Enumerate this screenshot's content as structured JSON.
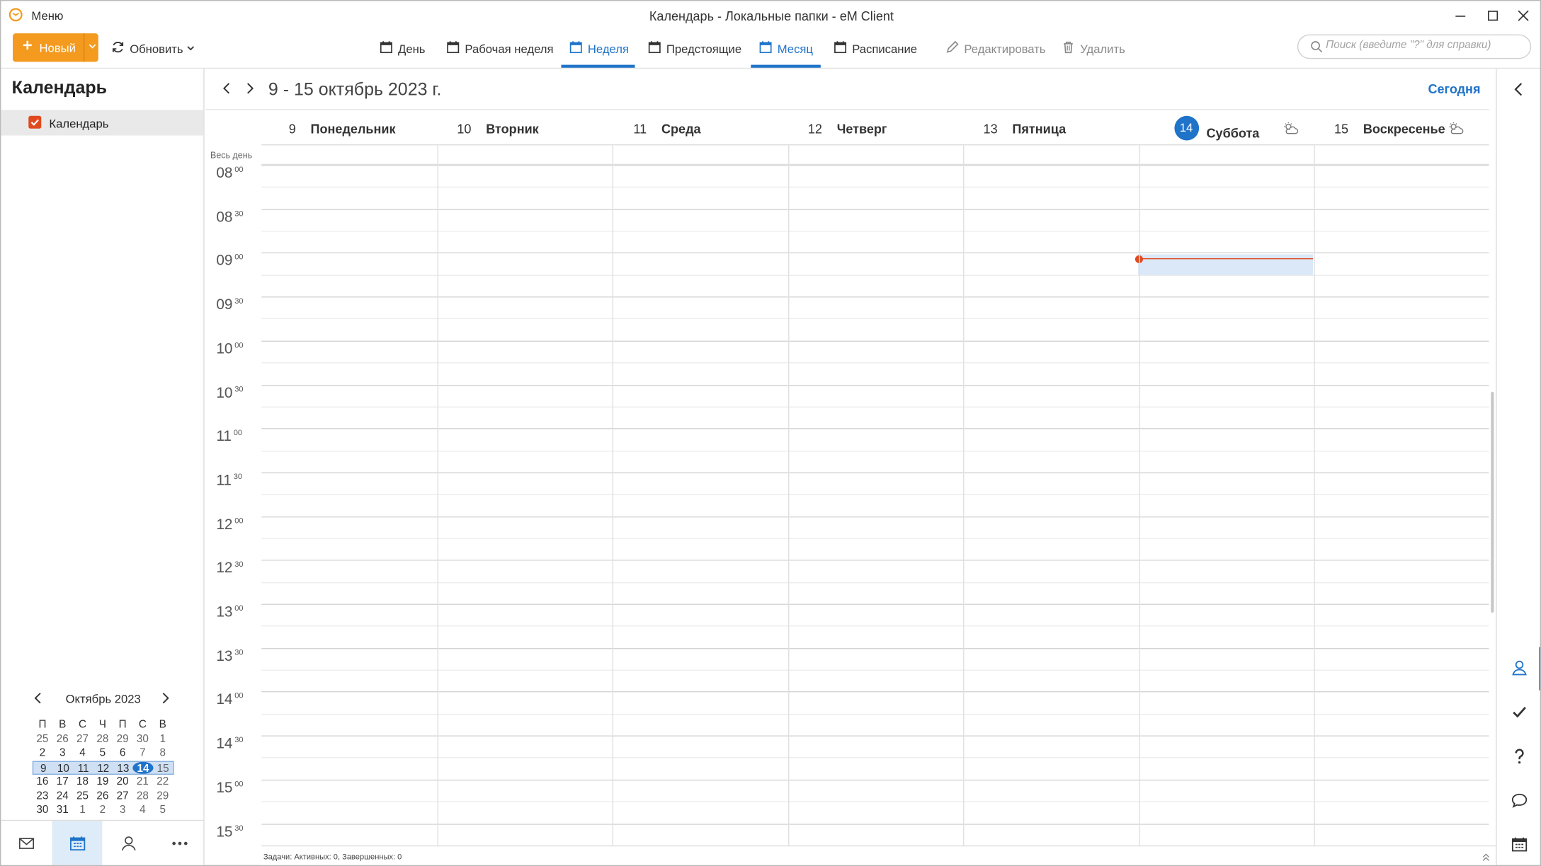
{
  "window": {
    "title": "Календарь - Локальные папки - eM Client",
    "menu_label": "Меню"
  },
  "toolbar": {
    "new_label": "Новый",
    "refresh_label": "Обновить",
    "views": [
      {
        "label": "День",
        "icon": "calendar-day-icon",
        "active": false
      },
      {
        "label": "Рабочая неделя",
        "icon": "calendar-workweek-icon",
        "active": false
      },
      {
        "label": "Неделя",
        "icon": "calendar-week-icon",
        "active": true
      },
      {
        "label": "Предстоящие",
        "icon": "calendar-upcoming-icon",
        "active": false
      },
      {
        "label": "Месяц",
        "icon": "calendar-month-icon",
        "active": true
      },
      {
        "label": "Расписание",
        "icon": "calendar-schedule-icon",
        "active": false
      }
    ],
    "edit_label": "Редактировать",
    "delete_label": "Удалить",
    "search_placeholder": "Поиск (введите \"?\" для справки)"
  },
  "sidebar": {
    "title": "Календарь",
    "calendars": [
      {
        "label": "Календарь",
        "checked": true,
        "color": "#e04a1f"
      }
    ]
  },
  "mini_calendar": {
    "title": "Октябрь 2023",
    "weekdays": [
      "П",
      "В",
      "С",
      "Ч",
      "П",
      "С",
      "В"
    ],
    "weeks": [
      [
        "25",
        "26",
        "27",
        "28",
        "29",
        "30",
        "1"
      ],
      [
        "2",
        "3",
        "4",
        "5",
        "6",
        "7",
        "8"
      ],
      [
        "9",
        "10",
        "11",
        "12",
        "13",
        "14",
        "15"
      ],
      [
        "16",
        "17",
        "18",
        "19",
        "20",
        "21",
        "22"
      ],
      [
        "23",
        "24",
        "25",
        "26",
        "27",
        "28",
        "29"
      ],
      [
        "30",
        "31",
        "1",
        "2",
        "3",
        "4",
        "5"
      ]
    ],
    "today": "14"
  },
  "main": {
    "range_title": "9 - 15 октябрь 2023 г.",
    "today_label": "Сегодня",
    "allday_label": "Весь день",
    "days": [
      {
        "num": "9",
        "name": "Понедельник"
      },
      {
        "num": "10",
        "name": "Вторник"
      },
      {
        "num": "11",
        "name": "Среда"
      },
      {
        "num": "12",
        "name": "Четверг"
      },
      {
        "num": "13",
        "name": "Пятница"
      },
      {
        "num": "14",
        "name": "Суббота",
        "today": true
      },
      {
        "num": "15",
        "name": "Воскресенье"
      }
    ],
    "times": [
      {
        "h": "08",
        "m": "00"
      },
      {
        "h": "08",
        "m": "30"
      },
      {
        "h": "09",
        "m": "00"
      },
      {
        "h": "09",
        "m": "30"
      },
      {
        "h": "10",
        "m": "00"
      },
      {
        "h": "10",
        "m": "30"
      },
      {
        "h": "11",
        "m": "00"
      },
      {
        "h": "11",
        "m": "30"
      },
      {
        "h": "12",
        "m": "00"
      },
      {
        "h": "12",
        "m": "30"
      },
      {
        "h": "13",
        "m": "00"
      },
      {
        "h": "13",
        "m": "30"
      },
      {
        "h": "14",
        "m": "00"
      },
      {
        "h": "14",
        "m": "30"
      },
      {
        "h": "15",
        "m": "00"
      },
      {
        "h": "15",
        "m": "30"
      }
    ],
    "status": "Задачи: Активных: 0, Завершенных: 0"
  },
  "colors": {
    "accent": "#1f73c9",
    "new_button": "#f39a1f",
    "now_line": "#e04a1f"
  }
}
